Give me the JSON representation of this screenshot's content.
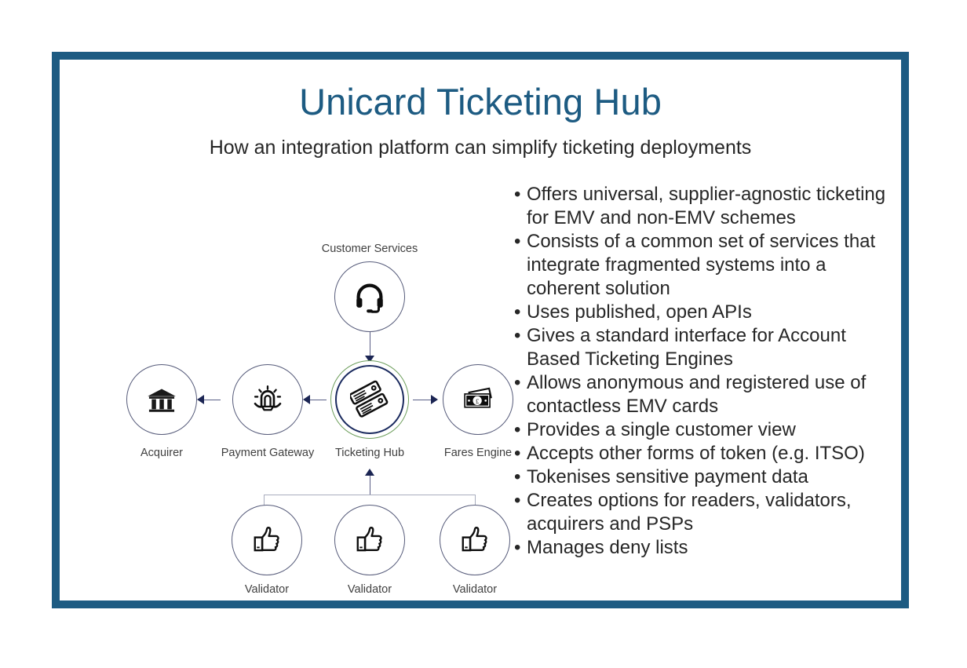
{
  "slide": {
    "title": "Unicard Ticketing Hub",
    "subtitle": "How an integration platform can simplify ticketing deployments",
    "frame_color": "#1d5b82",
    "title_color": "#1d5b82"
  },
  "diagram": {
    "hub": {
      "label": "Ticketing Hub",
      "icon": "tickets-icon",
      "outer_ring_color": "#6d9e5c",
      "inner_ring_color": "#1a2a5e"
    },
    "nodes": [
      {
        "id": "customer-services",
        "label": "Customer Services",
        "icon": "headset-icon"
      },
      {
        "id": "acquirer",
        "label": "Acquirer",
        "icon": "bank-icon"
      },
      {
        "id": "payment-gateway",
        "label": "Payment Gateway",
        "icon": "gateway-lamp-icon"
      },
      {
        "id": "fares-engine",
        "label": "Fares Engine",
        "icon": "banknote-pound-icon"
      }
    ],
    "validators": [
      {
        "id": "validator-1",
        "label": "Validator",
        "icon": "thumbs-up-icon"
      },
      {
        "id": "validator-2",
        "label": "Validator",
        "icon": "thumbs-up-icon"
      },
      {
        "id": "validator-3",
        "label": "Validator",
        "icon": "thumbs-up-icon"
      }
    ],
    "connector_color": "#8b8fa6",
    "arrow_color": "#1b2553"
  },
  "bullets": [
    "Offers universal, supplier-agnostic ticketing for EMV and non-EMV schemes",
    "Consists of a common set of services that integrate fragmented systems into a coherent solution",
    "Uses published, open APIs",
    "Gives a standard interface for Account Based Ticketing Engines",
    "Allows anonymous and registered use of contactless EMV cards",
    "Provides a single customer view",
    "Accepts other forms of token (e.g. ITSO)",
    "Tokenises sensitive payment data",
    "Creates options for readers, validators, acquirers and PSPs",
    "Manages deny lists"
  ],
  "bullet_marker": "•"
}
